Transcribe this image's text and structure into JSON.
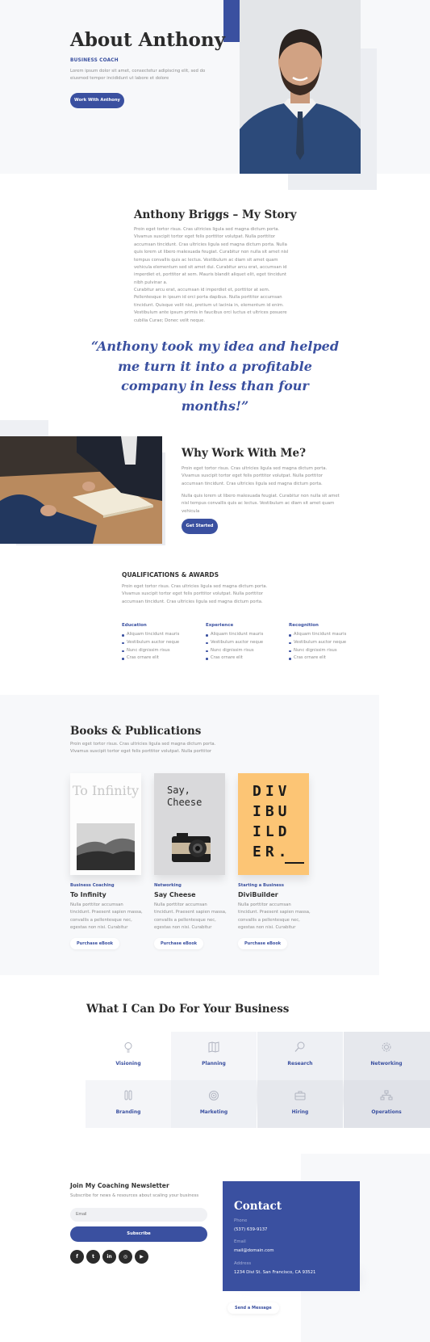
{
  "colors": {
    "accent": "#3a50a0",
    "heading": "#2b2b2b",
    "soft_bg": "#f7f8fa"
  },
  "hero": {
    "title": "About Anthony",
    "subtitle": "BUSINESS COACH",
    "description": "Lorem ipsum dolor sit amet, consectetur adipiscing elit, sed do eiusmod tempor incididunt ut labore et dolore",
    "button": "Work With Anthony"
  },
  "story": {
    "title": "Anthony Briggs – My Story",
    "paragraph1": "Proin eget tortor risus. Cras ultricies ligula sed magna dictum porta. Vivamus suscipit tortor eget felis porttitor volutpat. Nulla porttitor accumsan tincidunt. Cras ultricies ligula sed magna dictum porta. Nulla quis lorem ut libero malesuada feugiat. Curabitur non nulla sit amet nisl tempus convallis quis ac lectus. Vestibulum ac diam sit amet quam vehicula elementum sed sit amet dui. Curabitur arcu erat, accumsan id imperdiet et, porttitor at sem. Mauris blandit aliquet elit, eget tincidunt nibh pulvinar a.",
    "paragraph2": "Curabitur arcu erat, accumsan id imperdiet et, porttitor at sem. Pellentesque in ipsum id orci porta dapibus. Nulla porttitor accumsan tincidunt. Quisque velit nisi, pretium ut lacinia in, elementum id enim. Vestibulum ante ipsum primis in faucibus orci luctus et ultrices posuere cubilia Curae; Donec velit neque.",
    "quote": "“Anthony took my idea and helped me turn it into a profitable company in less than four months!”"
  },
  "why": {
    "title": "Why Work With Me?",
    "paragraph1": "Proin eget tortor risus. Cras ultricies ligula sed magna dictum porta. Vivamus suscipit tortor eget felis porttitor volutpat. Nulla porttitor accumsan tincidunt. Cras ultricies ligula sed magna dictum porta.",
    "paragraph2": "Nulla quis lorem ut libero malesuada feugiat. Curabitur non nulla sit amet nisl tempus convallis quis ac lectus. Vestibulum ac diam sit amet quam vehicula",
    "button": "Get Started"
  },
  "qualifications": {
    "title": "QUALIFICATIONS & AWARDS",
    "description": "Proin eget tortor risus. Cras ultricies ligula sed magna dictum porta. Vivamus suscipit tortor eget felis porttitor volutpat. Nulla porttitor accumsan tincidunt. Cras ultricies ligula sed magna dictum porta.",
    "columns": [
      {
        "heading": "Education",
        "items": [
          "Aliquam tincidunt mauris",
          "Vestibulum auctor neque",
          "Nunc dignissim risus",
          "Cras ornare elit"
        ]
      },
      {
        "heading": "Experience",
        "items": [
          "Aliquam tincidunt mauris",
          "Vestibulum auctor neque",
          "Nunc dignissim risus",
          "Cras ornare elit"
        ]
      },
      {
        "heading": "Recognition",
        "items": [
          "Aliquam tincidunt mauris",
          "Vestibulum auctor neque",
          "Nunc dignissim risus",
          "Cras ornare elit"
        ]
      }
    ]
  },
  "books": {
    "title": "Books & Publications",
    "description": "Proin eget tortor risus. Cras ultricies ligula sed magna dictum porta. Vivamus suscipit tortor eget felis porttitor volutpat. Nulla porttitor",
    "items": [
      {
        "category": "Business Coaching",
        "title": "To Infinity",
        "cover_text": "To Infinity",
        "description": "Nulla porttitor accumsan tincidunt. Praesent sapien massa, convallis a pellentesque nec, egestas non nisi. Curabitur",
        "button": "Purchase eBook"
      },
      {
        "category": "Networking",
        "title": "Say Cheese",
        "cover_text": "Say, Cheese",
        "description": "Nulla porttitor accumsan tincidunt. Praesent sapien massa, convallis a pellentesque nec, egestas non nisi. Curabitur",
        "button": "Purchase eBook"
      },
      {
        "category": "Starting a Business",
        "title": "DiviBuilder",
        "cover_lines": [
          "DIV",
          "IBU",
          "ILD",
          "ER."
        ],
        "description": "Nulla porttitor accumsan tincidunt. Praesent sapien massa, convallis a pellentesque nec, egestas non nisi. Curabitur",
        "button": "Purchase eBook"
      }
    ]
  },
  "services": {
    "title": "What I Can Do For Your Business",
    "items": [
      {
        "label": "Visioning",
        "icon": "lightbulb-icon"
      },
      {
        "label": "Planning",
        "icon": "map-icon"
      },
      {
        "label": "Research",
        "icon": "magnifier-icon"
      },
      {
        "label": "Networking",
        "icon": "gear-icon"
      },
      {
        "label": "Branding",
        "icon": "tags-icon"
      },
      {
        "label": "Marketing",
        "icon": "target-icon"
      },
      {
        "label": "Hiring",
        "icon": "briefcase-icon"
      },
      {
        "label": "Operations",
        "icon": "org-chart-icon"
      }
    ]
  },
  "newsletter": {
    "title": "Join My Coaching Newsletter",
    "description": "Subscribe for news & resources about scaling your business",
    "email_placeholder": "Email",
    "button": "Subscribe",
    "social": [
      {
        "name": "facebook-icon",
        "glyph": "f"
      },
      {
        "name": "twitter-icon",
        "glyph": "t"
      },
      {
        "name": "linkedin-icon",
        "glyph": "in"
      },
      {
        "name": "instagram-icon",
        "glyph": "◎"
      },
      {
        "name": "youtube-icon",
        "glyph": "▶"
      }
    ]
  },
  "contact": {
    "title": "Contact",
    "phone_label": "Phone",
    "phone": "(537) 639-9137",
    "email_label": "Email",
    "email": "mail@domain.com",
    "address_label": "Address",
    "address": "1234 Divi St. San Francisco, CA 93521",
    "button": "Send a Message"
  }
}
